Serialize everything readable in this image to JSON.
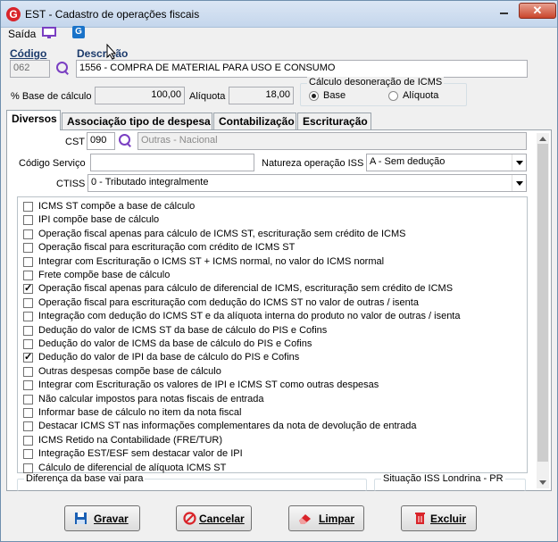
{
  "window": {
    "title": "EST - Cadastro de operações fiscais",
    "close_glyph": "✕",
    "app_icon": "G"
  },
  "menu": {
    "saida_label": "Saída",
    "icons": [
      "monitor-icon",
      "app-g-icon"
    ]
  },
  "header": {
    "codigo_label": "Código",
    "codigo_value": "062",
    "descricao_label": "Descrição",
    "descricao_value": "1556 - COMPRA DE MATERIAL PARA USO E CONSUMO",
    "base_calculo_label": "% Base de cálculo",
    "base_calculo_value": "100,00",
    "aliquota_label": "Alíquota",
    "aliquota_value": "18,00",
    "desoneracao_group": "Cálculo desoneração de ICMS",
    "radio_base": "Base",
    "radio_aliquota": "Alíquota",
    "selected_radio": "Base"
  },
  "tabs": [
    {
      "label": "Diversos",
      "selected": true
    },
    {
      "label": "Associação tipo de despesa",
      "selected": false
    },
    {
      "label": "Contabilização",
      "selected": false
    },
    {
      "label": "Escrituração",
      "selected": false
    }
  ],
  "diversos": {
    "cst_label": "CST",
    "cst_value": "090",
    "cst_desc": "Outras - Nacional",
    "codigo_servico_label": "Código Serviço",
    "codigo_servico_value": "",
    "natureza_label": "Natureza operação ISS",
    "natureza_value": "A - Sem dedução",
    "ctiss_label": "CTISS",
    "ctiss_value": "0 - Tributado integralmente"
  },
  "checkboxes": [
    {
      "label": "ICMS ST compõe a base de cálculo",
      "checked": false
    },
    {
      "label": "IPI compõe base de cálculo",
      "checked": false
    },
    {
      "label": "Operação fiscal apenas para cálculo de ICMS ST, escrituração sem crédito de ICMS",
      "checked": false
    },
    {
      "label": "Operação fiscal para escrituração com crédito de ICMS ST",
      "checked": false
    },
    {
      "label": "Integrar com Escrituração o ICMS ST + ICMS normal,  no valor do ICMS normal",
      "checked": false
    },
    {
      "label": "Frete compõe base de cálculo",
      "checked": false
    },
    {
      "label": "Operação fiscal apenas para cálculo de diferencial de ICMS, escrituração sem crédito de ICMS",
      "checked": true
    },
    {
      "label": "Operação fiscal para escrituração com dedução do ICMS ST no valor de outras / isenta",
      "checked": false
    },
    {
      "label": "Integração com dedução do ICMS ST e da alíquota interna do produto no valor de outras / isenta",
      "checked": false
    },
    {
      "label": "Dedução do valor de ICMS ST da base de cálculo do PIS e Cofins",
      "checked": false
    },
    {
      "label": "Dedução do valor de ICMS da base de cálculo do PIS e Cofins",
      "checked": false
    },
    {
      "label": "Dedução do valor de IPI da base de cálculo do PIS e Cofins",
      "checked": true
    },
    {
      "label": "Outras despesas compõe base de cálculo",
      "checked": false
    },
    {
      "label": "Integrar com Escrituração os valores de IPI e ICMS ST como outras despesas",
      "checked": false
    },
    {
      "label": "Não calcular impostos para notas fiscais de entrada",
      "checked": false
    },
    {
      "label": "Informar base de cálculo no item da nota fiscal",
      "checked": false
    },
    {
      "label": "Destacar ICMS ST nas informações complementares da nota de devolução de entrada",
      "checked": false
    },
    {
      "label": "ICMS Retido na Contabilidade (FRE/TUR)",
      "checked": false
    },
    {
      "label": "Integração EST/ESF sem destacar valor de IPI",
      "checked": false
    },
    {
      "label": "Cálculo de diferencial de alíquota ICMS ST",
      "checked": false
    }
  ],
  "bottom_groups": {
    "diferenca": "Diferença da base vai para",
    "situacao_iss": "Situação ISS Londrina - PR"
  },
  "buttons": {
    "gravar": "Gravar",
    "cancelar": "Cancelar",
    "limpar": "Limpar",
    "excluir": "Excluir"
  },
  "colors": {
    "accent": "#7a3fc2",
    "gravar_icon": "#1a5fb4",
    "cancelar_icon": "#d9242a",
    "limpar_icon": "#d9242a",
    "excluir_icon": "#d9242a"
  }
}
